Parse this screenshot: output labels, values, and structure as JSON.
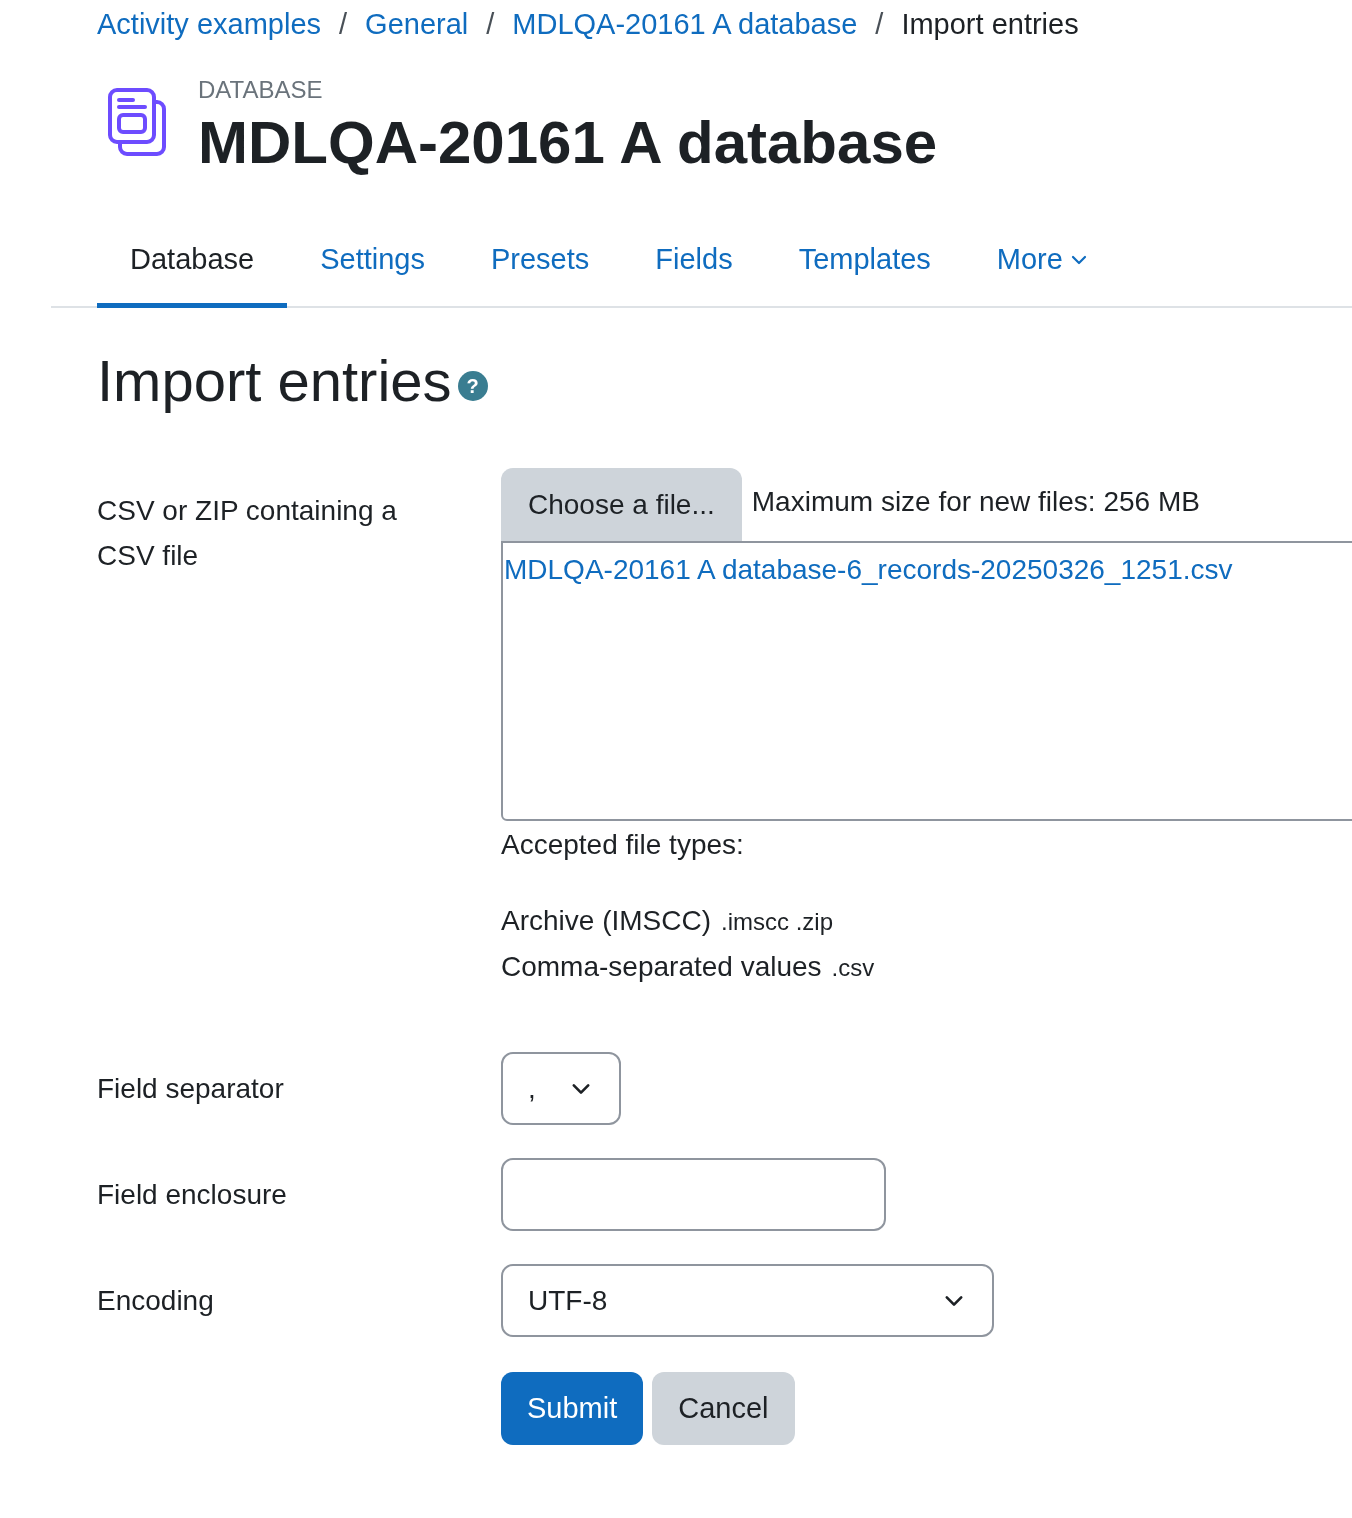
{
  "breadcrumbs": [
    {
      "label": "Activity examples",
      "current": false
    },
    {
      "label": "General",
      "current": false
    },
    {
      "label": "MDLQA-20161 A database",
      "current": false
    },
    {
      "label": "Import entries",
      "current": true
    }
  ],
  "breadcrumb_separator": "/",
  "header": {
    "kicker": "DATABASE",
    "title": "MDLQA-20161 A database"
  },
  "tabs": [
    {
      "label": "Database",
      "selected": true,
      "has_menu": false
    },
    {
      "label": "Settings",
      "selected": false,
      "has_menu": false
    },
    {
      "label": "Presets",
      "selected": false,
      "has_menu": false
    },
    {
      "label": "Fields",
      "selected": false,
      "has_menu": false
    },
    {
      "label": "Templates",
      "selected": false,
      "has_menu": false
    },
    {
      "label": "More",
      "selected": false,
      "has_menu": true
    }
  ],
  "page_title": "Import entries",
  "help_glyph": "?",
  "file_field": {
    "label": "CSV or ZIP containing a CSV file",
    "button": "Choose a file...",
    "max_size": "Maximum size for new files: 256 MB",
    "files": [
      "MDLQA-20161 A database-6_records-20250326_1251.csv"
    ],
    "accepted_label": "Accepted file types:",
    "types": [
      {
        "name": "Archive (IMSCC)",
        "extensions": ".imscc .zip"
      },
      {
        "name": "Comma-separated values",
        "extensions": ".csv"
      }
    ]
  },
  "fields": [
    {
      "kind": "select",
      "label": "Field separator",
      "value": ","
    },
    {
      "kind": "text",
      "label": "Field enclosure"
    },
    {
      "kind": "select",
      "label": "Encoding",
      "value": "UTF-8"
    }
  ],
  "buttons": [
    {
      "label": "Submit",
      "kind": "primary"
    },
    {
      "label": "Cancel",
      "kind": "secondary"
    }
  ]
}
